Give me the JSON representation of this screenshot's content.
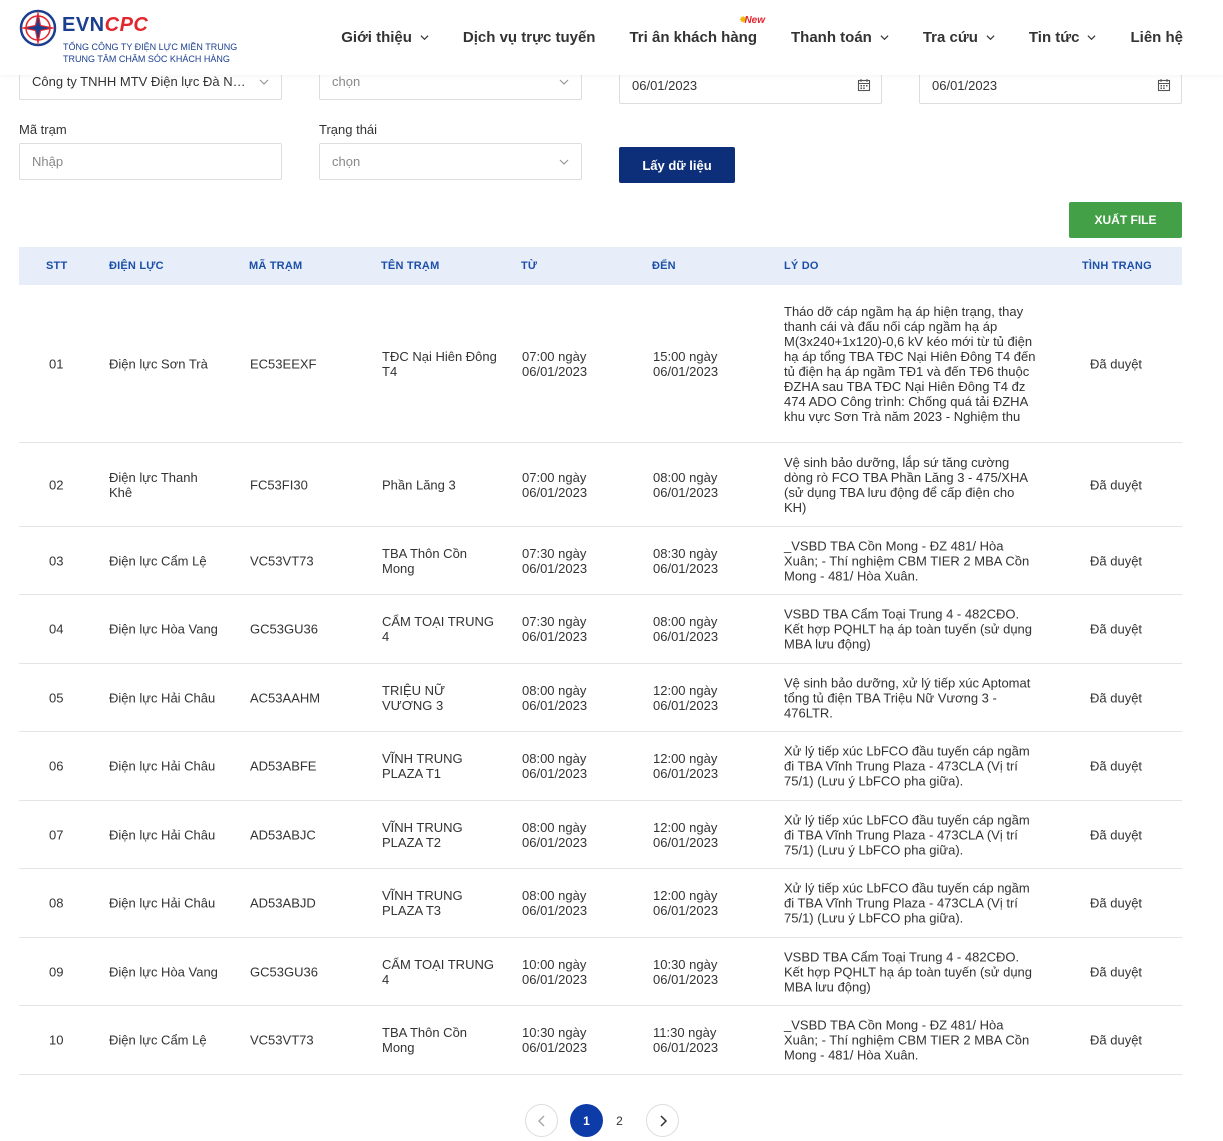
{
  "header": {
    "brand_evn": "EVN",
    "brand_cpc": "CPC",
    "sub1": "TỔNG CÔNG TY ĐIỆN LỰC MIỀN TRUNG",
    "sub2": "TRUNG TÂM CHĂM SÓC KHÁCH HÀNG",
    "new_badge": "New",
    "nav": [
      {
        "label": "Giới thiệu",
        "dropdown": true
      },
      {
        "label": "Dịch vụ trực tuyến",
        "dropdown": false
      },
      {
        "label": "Tri ân khách hàng",
        "dropdown": false
      },
      {
        "label": "Thanh toán",
        "dropdown": true
      },
      {
        "label": "Tra cứu",
        "dropdown": true
      },
      {
        "label": "Tin tức",
        "dropdown": true
      },
      {
        "label": "Liên hệ",
        "dropdown": false
      }
    ]
  },
  "filters": {
    "company": "Công ty TNHH MTV Điện lực Đà Nẵng",
    "unit_select": "chọn",
    "from_date": "06/01/2023",
    "to_date": "06/01/2023",
    "station_label": "Mã trạm",
    "station_placeholder": "Nhập",
    "status_label": "Trạng thái",
    "status_select": "chọn",
    "fetch_button": "Lấy dữ liệu",
    "export_button": "XUẤT FILE"
  },
  "table": {
    "headers": [
      "STT",
      "ĐIỆN LỰC",
      "MÃ TRẠM",
      "TÊN TRẠM",
      "TỪ",
      "ĐẾN",
      "LÝ DO",
      "TÌNH TRẠNG"
    ],
    "rows": [
      {
        "stt": "01",
        "dienluc": "Điện lực Sơn Trà",
        "matram": "EC53EEXF",
        "tentram": "TĐC Nại Hiên Đông T4",
        "tu": "07:00 ngày 06/01/2023",
        "den": "15:00 ngày 06/01/2023",
        "lydo": "Tháo dỡ cáp ngầm hạ áp hiện trạng, thay thanh cái và đấu nối cáp ngầm hạ áp M(3x240+1x120)-0,6 kV kéo mới từ tủ điện hạ áp tổng TBA TĐC Nại Hiên Đông T4 đến tủ điện hạ áp ngầm TĐ1 và đến TĐ6 thuộc ĐZHA sau TBA TĐC Nại Hiên Đông T4 đz 474 ADO Công trình: Chống quá tải ĐZHA khu vực Sơn Trà năm 2023 - Nghiệm thu",
        "tinhtrang": "Đã duyệt"
      },
      {
        "stt": "02",
        "dienluc": "Điện lực Thanh Khê",
        "matram": "FC53FI30",
        "tentram": "Phần Lăng 3",
        "tu": "07:00 ngày 06/01/2023",
        "den": "08:00 ngày 06/01/2023",
        "lydo": "Vệ sinh bảo dưỡng, lắp sứ tăng cường dòng rò FCO TBA Phần Lăng 3 - 475/XHA (sử dụng TBA lưu động để cấp điện cho KH)",
        "tinhtrang": "Đã duyệt"
      },
      {
        "stt": "03",
        "dienluc": "Điện lực Cẩm Lệ",
        "matram": "VC53VT73",
        "tentram": "TBA Thôn Cồn Mong",
        "tu": "07:30 ngày 06/01/2023",
        "den": "08:30 ngày 06/01/2023",
        "lydo": "_VSBD TBA Cồn Mong - ĐZ 481/ Hòa Xuân; - Thí nghiệm CBM TIER 2 MBA Cồn Mong - 481/ Hòa Xuân.",
        "tinhtrang": "Đã duyệt"
      },
      {
        "stt": "04",
        "dienluc": "Điện lực Hòa Vang",
        "matram": "GC53GU36",
        "tentram": "CẨM TOẠI TRUNG 4",
        "tu": "07:30 ngày 06/01/2023",
        "den": "08:00 ngày 06/01/2023",
        "lydo": "VSBD TBA Cẩm Toại Trung 4 - 482CĐO. Kết hợp PQHLT hạ áp toàn tuyến (sử dụng MBA lưu động)",
        "tinhtrang": "Đã duyệt"
      },
      {
        "stt": "05",
        "dienluc": "Điện lực Hải Châu",
        "matram": "AC53AAHM",
        "tentram": "TRIỆU NỮ VƯƠNG 3",
        "tu": "08:00 ngày 06/01/2023",
        "den": "12:00 ngày 06/01/2023",
        "lydo": "Vệ sinh bảo dưỡng, xử lý tiếp xúc Aptomat tổng tủ điện TBA Triệu Nữ Vương 3 - 476LTR.",
        "tinhtrang": "Đã duyệt"
      },
      {
        "stt": "06",
        "dienluc": "Điện lực Hải Châu",
        "matram": "AD53ABFE",
        "tentram": "VĨNH TRUNG PLAZA T1",
        "tu": "08:00 ngày 06/01/2023",
        "den": "12:00 ngày 06/01/2023",
        "lydo": "Xử lý tiếp xúc LbFCO đầu tuyến cáp ngầm đi TBA Vĩnh Trung Plaza - 473CLA (Vị trí 75/1) (Lưu ý LbFCO pha giữa).",
        "tinhtrang": "Đã duyệt"
      },
      {
        "stt": "07",
        "dienluc": "Điện lực Hải Châu",
        "matram": "AD53ABJC",
        "tentram": "VĨNH TRUNG PLAZA T2",
        "tu": "08:00 ngày 06/01/2023",
        "den": "12:00 ngày 06/01/2023",
        "lydo": "Xử lý tiếp xúc LbFCO đầu tuyến cáp ngầm đi TBA Vĩnh Trung Plaza - 473CLA (Vị trí 75/1) (Lưu ý LbFCO pha giữa).",
        "tinhtrang": "Đã duyệt"
      },
      {
        "stt": "08",
        "dienluc": "Điện lực Hải Châu",
        "matram": "AD53ABJD",
        "tentram": "VĨNH TRUNG PLAZA T3",
        "tu": "08:00 ngày 06/01/2023",
        "den": "12:00 ngày 06/01/2023",
        "lydo": "Xử lý tiếp xúc LbFCO đầu tuyến cáp ngầm đi TBA Vĩnh Trung Plaza - 473CLA (Vị trí 75/1) (Lưu ý LbFCO pha giữa).",
        "tinhtrang": "Đã duyệt"
      },
      {
        "stt": "09",
        "dienluc": "Điện lực Hòa Vang",
        "matram": "GC53GU36",
        "tentram": "CẨM TOẠI TRUNG 4",
        "tu": "10:00 ngày 06/01/2023",
        "den": "10:30 ngày 06/01/2023",
        "lydo": "VSBD TBA Cẩm Toại Trung 4 - 482CĐO. Kết hợp PQHLT hạ áp toàn tuyến (sử dụng MBA lưu động)",
        "tinhtrang": "Đã duyệt"
      },
      {
        "stt": "10",
        "dienluc": "Điện lực Cẩm Lệ",
        "matram": "VC53VT73",
        "tentram": "TBA Thôn Cồn Mong",
        "tu": "10:30 ngày 06/01/2023",
        "den": "11:30 ngày 06/01/2023",
        "lydo": "_VSBD TBA Cồn Mong - ĐZ 481/ Hòa Xuân; - Thí nghiệm CBM TIER 2 MBA Cồn Mong - 481/ Hòa Xuân.",
        "tinhtrang": "Đã duyệt"
      }
    ]
  },
  "pagination": {
    "pages": [
      "1",
      "2"
    ],
    "current": "1"
  },
  "colors": {
    "primary": "#0d2f7a",
    "accent_red": "#e3262e",
    "export_green": "#43a047",
    "header_row": "#e7eef9"
  }
}
